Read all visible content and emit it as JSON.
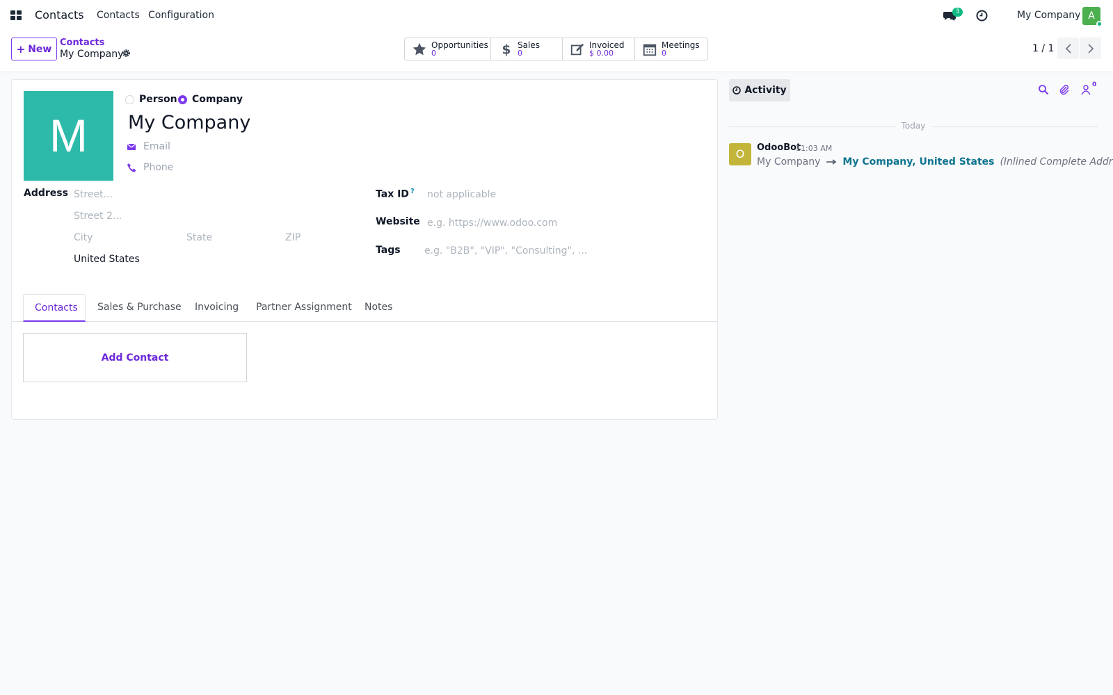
{
  "app": {
    "name": "Contacts",
    "menu": [
      "Contacts",
      "Configuration"
    ]
  },
  "topbar": {
    "chat_count": "3",
    "company": "My Company",
    "user_initial": "A"
  },
  "breadcrumb": {
    "parent": "Contacts",
    "current": "My Company"
  },
  "new_button": "New",
  "smart_buttons": [
    {
      "label": "Opportunities",
      "value": "0",
      "icon": "star-icon"
    },
    {
      "label": "Sales",
      "value": "0",
      "icon": "dollar-icon"
    },
    {
      "label": "Invoiced",
      "value": "$ 0.00",
      "icon": "edit-icon"
    },
    {
      "label": "Meetings",
      "value": "0",
      "icon": "calendar-icon"
    }
  ],
  "pager": "1 / 1",
  "form": {
    "avatar_letter": "M",
    "type_options": [
      "Person",
      "Company"
    ],
    "type_selected": "Company",
    "name": "My Company",
    "email_placeholder": "Email",
    "phone_placeholder": "Phone",
    "address_label": "Address",
    "street_placeholder": "Street...",
    "street2_placeholder": "Street 2...",
    "city_placeholder": "City",
    "state_placeholder": "State",
    "zip_placeholder": "ZIP",
    "country": "United States",
    "tax_id_label": "Tax ID",
    "tax_id_help": "?",
    "tax_id_placeholder": "not applicable",
    "website_label": "Website",
    "website_placeholder": "e.g. https://www.odoo.com",
    "tags_label": "Tags",
    "tags_placeholder": "e.g. \"B2B\", \"VIP\", \"Consulting\", ..."
  },
  "tabs": [
    "Contacts",
    "Sales & Purchase",
    "Invoicing",
    "Partner Assignment",
    "Notes"
  ],
  "active_tab": "Contacts",
  "add_contact": "Add Contact",
  "chatter": {
    "activity_label": "Activity",
    "followers_count": "0",
    "date_separator": "Today",
    "message": {
      "avatar_letter": "O",
      "author": "OdooBot",
      "time": "11:03 AM",
      "old_value": "My Company",
      "new_value": "My Company, United States",
      "field_note": "(Inlined Complete Address)"
    }
  },
  "colors": {
    "accent": "#7c3aed",
    "avatar_company": "#2ebaaa",
    "avatar_bot": "#c2b53a",
    "avatar_user": "#4caf50",
    "badge": "#10b981"
  }
}
